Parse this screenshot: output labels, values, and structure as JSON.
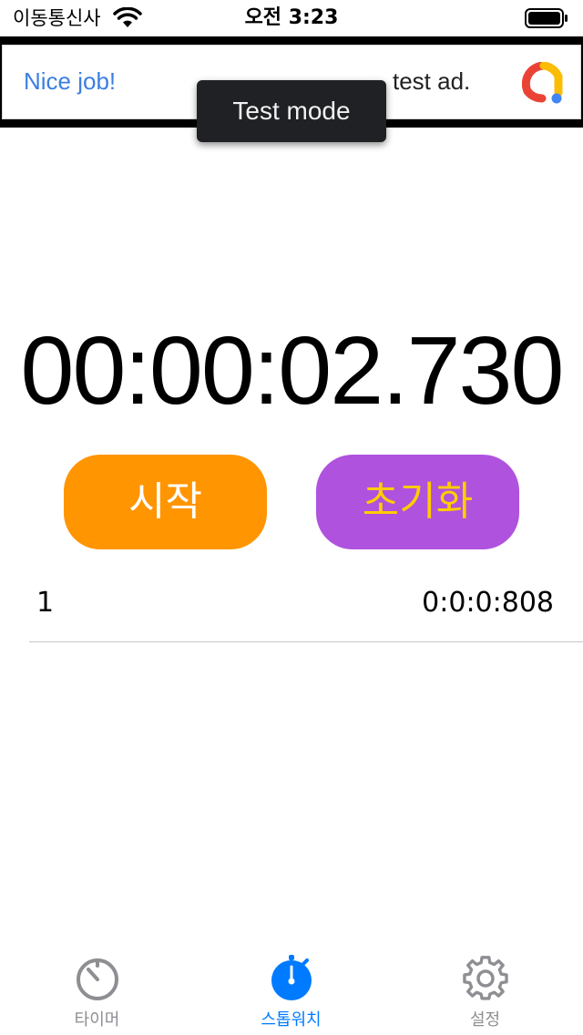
{
  "status_bar": {
    "carrier": "이동통신사",
    "time": "오전 3:23"
  },
  "ad": {
    "headline": "Nice job!",
    "body": "test ad.",
    "toast": "Test mode"
  },
  "stopwatch": {
    "time": "00:00:02.730",
    "start_label": "시작",
    "reset_label": "초기화"
  },
  "laps": [
    {
      "index": "1",
      "time": "0:0:0:808"
    }
  ],
  "tab_bar": {
    "tabs": [
      {
        "label": "타이머",
        "icon": "timer-icon",
        "active": false
      },
      {
        "label": "스톱워치",
        "icon": "stopwatch-icon",
        "active": true
      },
      {
        "label": "설정",
        "icon": "gear-icon",
        "active": false
      }
    ]
  },
  "colors": {
    "start_button": "#ff9500",
    "reset_button": "#af52de",
    "reset_text": "#ffcc00",
    "active_tab": "#007aff",
    "inactive_tab": "#8e8e93"
  }
}
